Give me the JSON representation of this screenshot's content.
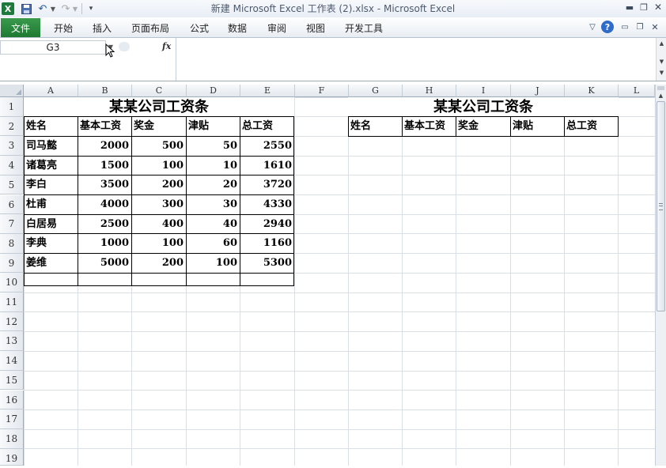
{
  "window": {
    "title": "新建 Microsoft Excel 工作表 (2).xlsx  -  Microsoft Excel",
    "logo_letter": "X"
  },
  "ribbon": {
    "file": "文件",
    "tabs": [
      "开始",
      "插入",
      "页面布局",
      "公式",
      "数据",
      "审阅",
      "视图",
      "开发工具"
    ],
    "help": "?"
  },
  "formula_bar": {
    "name_box": "G3",
    "fx_label": "fx",
    "content": ""
  },
  "sheet": {
    "columns": [
      "A",
      "B",
      "C",
      "D",
      "E",
      "F",
      "G",
      "H",
      "I",
      "J",
      "K",
      "L"
    ],
    "rows": [
      "1",
      "2",
      "3",
      "4",
      "5",
      "6",
      "7",
      "8",
      "9",
      "10",
      "11",
      "12",
      "13",
      "14",
      "15",
      "16",
      "17",
      "18",
      "19"
    ],
    "left_table": {
      "title": "某某公司工资条",
      "headers": [
        "姓名",
        "基本工资",
        "奖金",
        "津贴",
        "总工资"
      ],
      "rows": [
        [
          "司马懿",
          "2000",
          "500",
          "50",
          "2550"
        ],
        [
          "诸葛亮",
          "1500",
          "100",
          "10",
          "1610"
        ],
        [
          "李白",
          "3500",
          "200",
          "20",
          "3720"
        ],
        [
          "杜甫",
          "4000",
          "300",
          "30",
          "4330"
        ],
        [
          "白居易",
          "2500",
          "400",
          "40",
          "2940"
        ],
        [
          "李典",
          "1000",
          "100",
          "60",
          "1160"
        ],
        [
          "姜维",
          "5000",
          "200",
          "100",
          "5300"
        ]
      ]
    },
    "right_table": {
      "title": "某某公司工资条",
      "headers": [
        "姓名",
        "基本工资",
        "奖金",
        "津贴",
        "总工资"
      ]
    }
  },
  "colors": {
    "file_tab": "#1e7a33",
    "help_icon": "#2f6bc9",
    "gridline": "#dadfe6",
    "border": "#000000"
  }
}
